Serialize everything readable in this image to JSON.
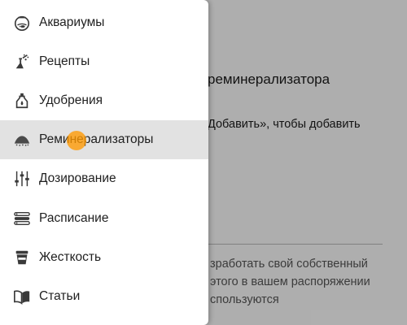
{
  "background": {
    "title": "реминерализатора",
    "hint": "Добавить», чтобы добавить",
    "info_lines": [
      "зработать свой собственный",
      "этого в вашем распоряжении",
      "спользуются"
    ]
  },
  "drawer": {
    "items": [
      {
        "label": "Аквариумы",
        "icon": "aquarium-icon",
        "active": false
      },
      {
        "label": "Рецепты",
        "icon": "recipe-flask-icon",
        "active": false
      },
      {
        "label": "Удобрения",
        "icon": "fertilizer-bottle-icon",
        "active": false
      },
      {
        "label": "Реминерализаторы",
        "icon": "remineralizer-pile-icon",
        "active": true
      },
      {
        "label": "Дозирование",
        "icon": "dosing-sliders-icon",
        "active": false
      },
      {
        "label": "Расписание",
        "icon": "schedule-icon",
        "active": false
      },
      {
        "label": "Жесткость",
        "icon": "hardness-cup-icon",
        "active": false
      },
      {
        "label": "Статьи",
        "icon": "articles-book-icon",
        "active": false
      }
    ]
  },
  "colors": {
    "active_item_bg": "#e2e2e2",
    "touch_indicator": "#ff9800",
    "scrim": "rgba(0,0,0,0.30)"
  }
}
